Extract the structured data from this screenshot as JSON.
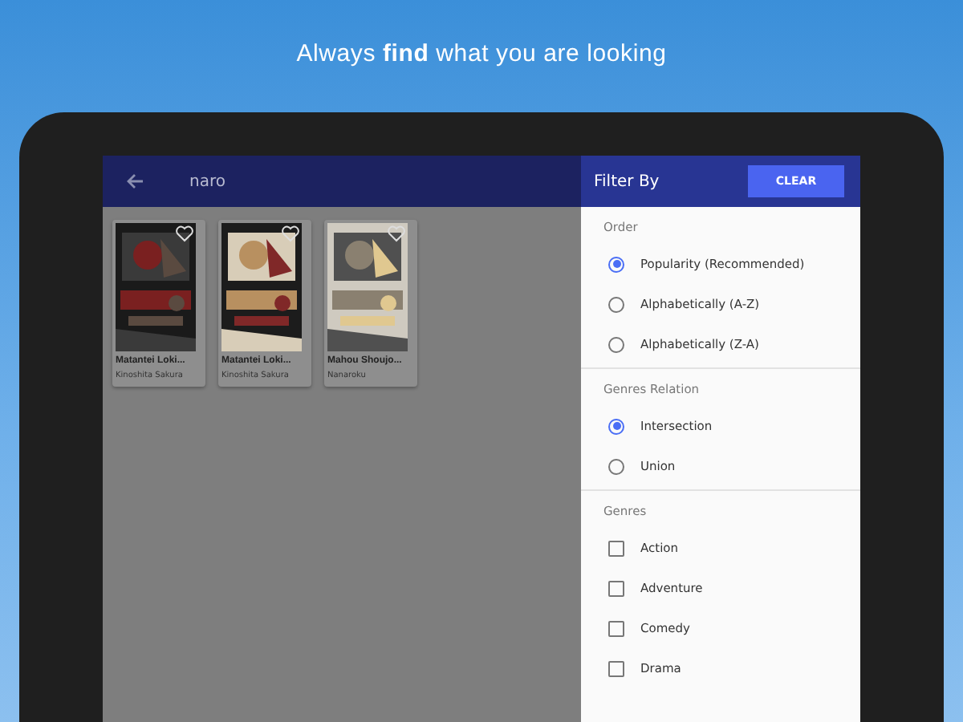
{
  "headline": "Always **find** what you are looking",
  "search": {
    "value": "naro"
  },
  "results": [
    {
      "title": "Matantei Loki...",
      "author": "Kinoshita Sakura"
    },
    {
      "title": "Matantei Loki...",
      "author": "Kinoshita Sakura"
    },
    {
      "title": "Mahou Shoujo...",
      "author": "Nanaroku"
    }
  ],
  "filter": {
    "title": "Filter By",
    "clear": "CLEAR",
    "sections": [
      {
        "label": "Order",
        "kind": "radio",
        "options": [
          {
            "label": "Popularity (Recommended)",
            "selected": true
          },
          {
            "label": "Alphabetically (A-Z)",
            "selected": false
          },
          {
            "label": "Alphabetically (Z-A)",
            "selected": false
          }
        ]
      },
      {
        "label": "Genres Relation",
        "kind": "radio",
        "options": [
          {
            "label": "Intersection",
            "selected": true
          },
          {
            "label": "Union",
            "selected": false
          }
        ]
      },
      {
        "label": "Genres",
        "kind": "checkbox",
        "options": [
          {
            "label": "Action",
            "checked": false
          },
          {
            "label": "Adventure",
            "checked": false
          },
          {
            "label": "Comedy",
            "checked": false
          },
          {
            "label": "Drama",
            "checked": false
          }
        ]
      }
    ]
  }
}
